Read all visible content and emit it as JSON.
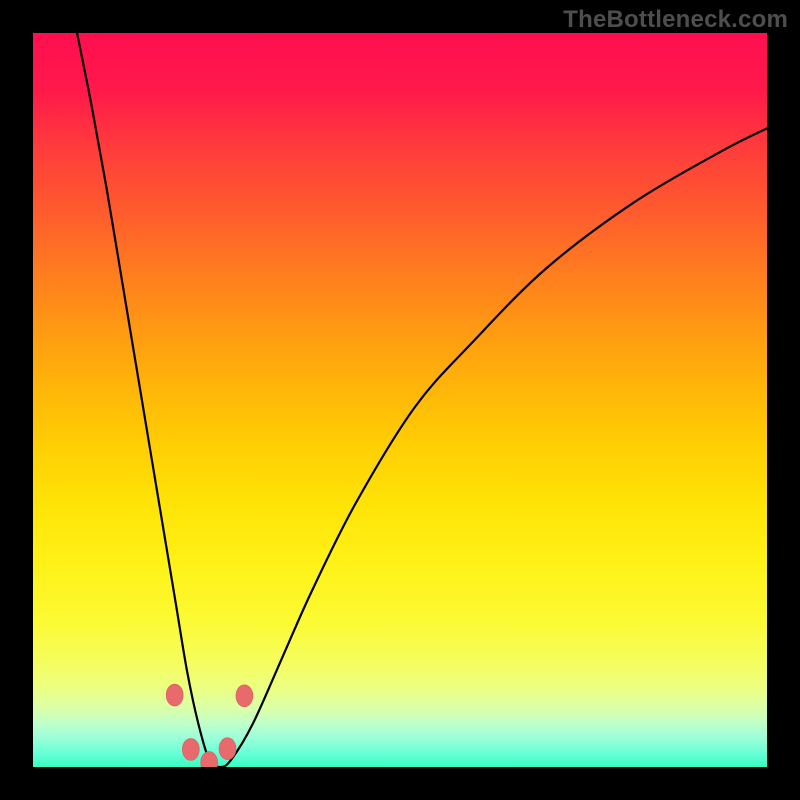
{
  "watermark": {
    "text": "TheBottleneck.com"
  },
  "colors": {
    "frame": "#000000",
    "curve": "#000000",
    "marker_fill": "#e96a6c",
    "marker_stroke": "#d95a5c"
  },
  "chart_data": {
    "type": "line",
    "title": "",
    "xlabel": "",
    "ylabel": "",
    "xlim": [
      0,
      100
    ],
    "ylim": [
      0,
      100
    ],
    "grid": false,
    "series": [
      {
        "name": "bottleneck-curve",
        "x": [
          6,
          8,
          10,
          12,
          14,
          16,
          18,
          19.5,
          21,
          22.5,
          24,
          25.5,
          27,
          30,
          34,
          38,
          44,
          52,
          60,
          70,
          82,
          94,
          100
        ],
        "y": [
          100,
          90,
          79,
          67,
          55,
          43,
          31,
          22,
          13,
          6,
          1,
          0,
          1,
          6,
          15,
          24,
          36,
          49,
          58,
          68,
          77,
          84,
          87
        ]
      }
    ],
    "markers": [
      {
        "x": 19.3,
        "y": 9.8
      },
      {
        "x": 21.5,
        "y": 2.4
      },
      {
        "x": 24.0,
        "y": 0.6
      },
      {
        "x": 26.5,
        "y": 2.5
      },
      {
        "x": 28.8,
        "y": 9.7
      }
    ],
    "annotations": []
  }
}
